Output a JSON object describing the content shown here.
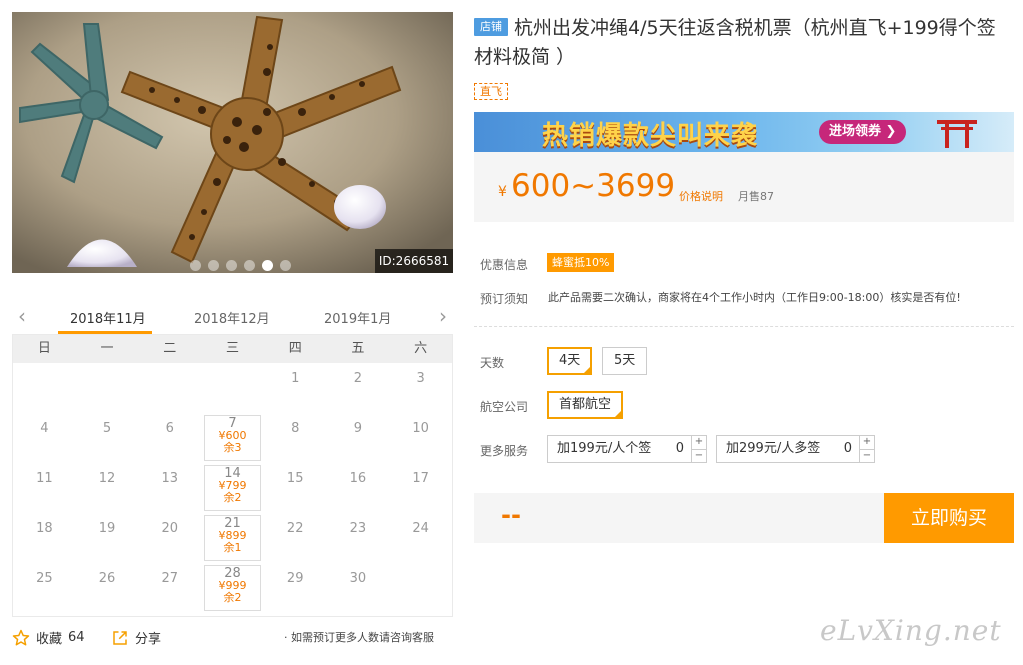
{
  "gallery": {
    "id_badge": "ID:2666581",
    "dot_count": 6,
    "active_dot": 4
  },
  "calendar": {
    "months": [
      "2018年11月",
      "2018年12月",
      "2019年1月"
    ],
    "active_month": "2018年11月",
    "weekdays": [
      "日",
      "一",
      "二",
      "三",
      "四",
      "五",
      "六"
    ],
    "rows": [
      [
        {
          "d": ""
        },
        {
          "d": ""
        },
        {
          "d": ""
        },
        {
          "d": ""
        },
        {
          "d": "1"
        },
        {
          "d": "2"
        },
        {
          "d": "3"
        }
      ],
      [
        {
          "d": "4"
        },
        {
          "d": "5"
        },
        {
          "d": "6"
        },
        {
          "d": "7",
          "price": "¥600",
          "remain": "余3"
        },
        {
          "d": "8"
        },
        {
          "d": "9"
        },
        {
          "d": "10"
        }
      ],
      [
        {
          "d": "11"
        },
        {
          "d": "12"
        },
        {
          "d": "13"
        },
        {
          "d": "14",
          "price": "¥799",
          "remain": "余2"
        },
        {
          "d": "15"
        },
        {
          "d": "16"
        },
        {
          "d": "17"
        }
      ],
      [
        {
          "d": "18"
        },
        {
          "d": "19"
        },
        {
          "d": "20"
        },
        {
          "d": "21",
          "price": "¥899",
          "remain": "余1"
        },
        {
          "d": "22"
        },
        {
          "d": "23"
        },
        {
          "d": "24"
        }
      ],
      [
        {
          "d": "25"
        },
        {
          "d": "26"
        },
        {
          "d": "27"
        },
        {
          "d": "28",
          "price": "¥999",
          "remain": "余2"
        },
        {
          "d": "29"
        },
        {
          "d": "30"
        },
        {
          "d": ""
        }
      ]
    ]
  },
  "footer": {
    "favorite_label": "收藏",
    "favorite_count": "64",
    "share_label": "分享",
    "consult_text": "· 如需预订更多人数请咨询客服"
  },
  "product": {
    "shop_tag": "店铺",
    "title": "杭州出发冲绳4/5天往返含税机票（杭州直飞+199得个签 材料极简 ）",
    "direct_tag": "直飞"
  },
  "banner": {
    "text": "热销爆款尖叫来袭",
    "button": "进场领券 ❯"
  },
  "price": {
    "currency": "¥",
    "range": "600~3699",
    "explain_link": "价格说明",
    "monthly_sales": "月售87"
  },
  "info": {
    "promo_label": "优惠信息",
    "promo_badge": "蜂蜜抵10%",
    "notice_label": "预订须知",
    "notice_text": "此产品需要二次确认，商家将在4个工作小时内（工作日9:00-18:00）核实是否有位!"
  },
  "options": {
    "days_label": "天数",
    "days": [
      "4天",
      "5天"
    ],
    "days_selected": "4天",
    "airline_label": "航空公司",
    "airline": "首都航空",
    "services_label": "更多服务",
    "services": [
      {
        "label": "加199元/人个签",
        "qty": "0"
      },
      {
        "label": "加299元/人多签",
        "qty": "0"
      }
    ]
  },
  "purchase": {
    "total": "--",
    "buy_label": "立即购买"
  },
  "watermark": "eLvXing.net",
  "colors": {
    "accent": "#ff9a00",
    "price": "#f07800",
    "shop_tag": "#4e9ce0"
  }
}
